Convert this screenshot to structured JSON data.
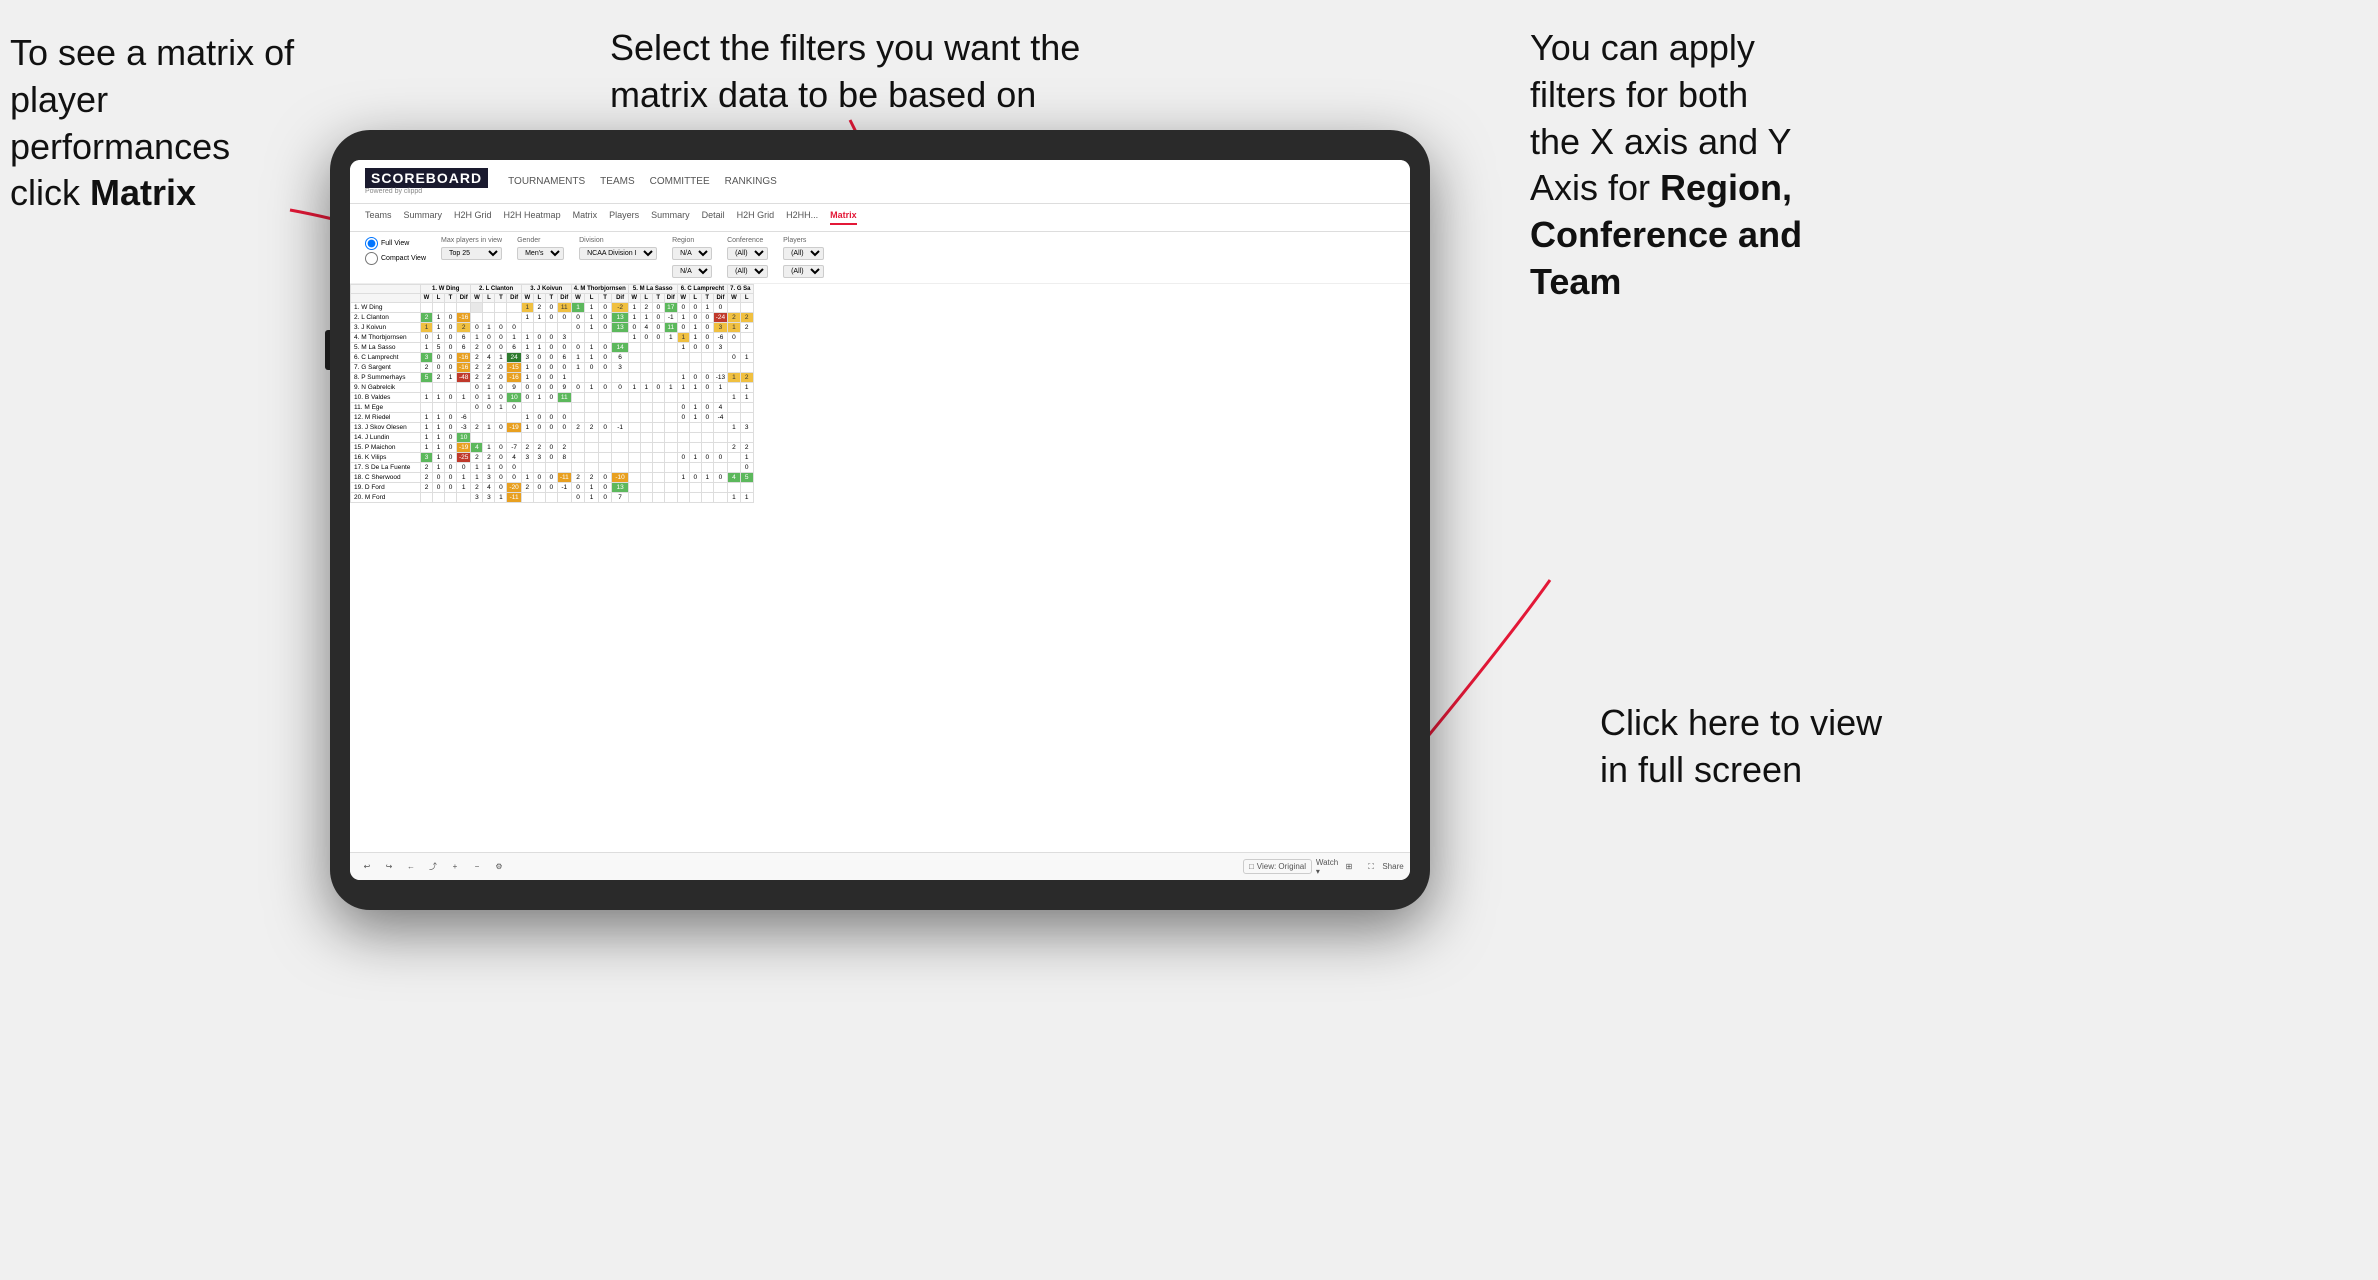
{
  "annotations": {
    "top_left": {
      "line1": "To see a matrix of",
      "line2": "player performances",
      "line3_prefix": "click ",
      "line3_bold": "Matrix"
    },
    "top_center": {
      "line1": "Select the filters you want the",
      "line2": "matrix data to be based on"
    },
    "top_right": {
      "line1": "You  can apply",
      "line2": "filters for both",
      "line3": "the X axis and Y",
      "line4_prefix": "Axis for ",
      "line4_bold": "Region,",
      "line5_bold": "Conference and",
      "line6_bold": "Team"
    },
    "bottom_right": {
      "line1": "Click here to view",
      "line2": "in full screen"
    }
  },
  "app": {
    "logo": "SCOREBOARD",
    "logo_sub": "Powered by clippd",
    "nav": [
      "TOURNAMENTS",
      "TEAMS",
      "COMMITTEE",
      "RANKINGS"
    ],
    "sub_tabs": [
      "Teams",
      "Summary",
      "H2H Grid",
      "H2H Heatmap",
      "Matrix",
      "Players",
      "Summary",
      "Detail",
      "H2H Grid",
      "H2HH...",
      "Matrix"
    ],
    "active_tab": "Matrix",
    "filters": {
      "view_options": [
        "Full View",
        "Compact View"
      ],
      "max_players_label": "Max players in view",
      "max_players_value": "Top 25",
      "gender_label": "Gender",
      "gender_value": "Men's",
      "division_label": "Division",
      "division_value": "NCAA Division I",
      "region_label": "Region",
      "region_value": "N/A",
      "conference_label": "Conference",
      "conference_value": "(All)",
      "players_label": "Players",
      "players_value": "(All)"
    },
    "col_headers": [
      "1. W Ding",
      "2. L Clanton",
      "3. J Koivun",
      "4. M Thorbjornsen",
      "5. M La Sasso",
      "6. C Lamprecht",
      "7. G Sa"
    ],
    "sub_headers": [
      "W",
      "L",
      "T",
      "Dif"
    ],
    "players": [
      {
        "name": "1. W Ding",
        "data": []
      },
      {
        "name": "2. L Clanton",
        "data": []
      },
      {
        "name": "3. J Koivun",
        "data": []
      },
      {
        "name": "4. M Thorbjornsen",
        "data": []
      },
      {
        "name": "5. M La Sasso",
        "data": []
      },
      {
        "name": "6. C Lamprecht",
        "data": []
      },
      {
        "name": "7. G Sargent",
        "data": []
      },
      {
        "name": "8. P Summerhays",
        "data": []
      },
      {
        "name": "9. N Gabrelcik",
        "data": []
      },
      {
        "name": "10. B Valdes",
        "data": []
      },
      {
        "name": "11. M Ege",
        "data": []
      },
      {
        "name": "12. M Riedel",
        "data": []
      },
      {
        "name": "13. J Skov Olesen",
        "data": []
      },
      {
        "name": "14. J Lundin",
        "data": []
      },
      {
        "name": "15. P Maichon",
        "data": []
      },
      {
        "name": "16. K Vilips",
        "data": []
      },
      {
        "name": "17. S De La Fuente",
        "data": []
      },
      {
        "name": "18. C Sherwood",
        "data": []
      },
      {
        "name": "19. D Ford",
        "data": []
      },
      {
        "name": "20. M Ford",
        "data": []
      }
    ],
    "toolbar": {
      "view_original": "View: Original",
      "watch": "Watch ▾",
      "share": "Share"
    }
  }
}
